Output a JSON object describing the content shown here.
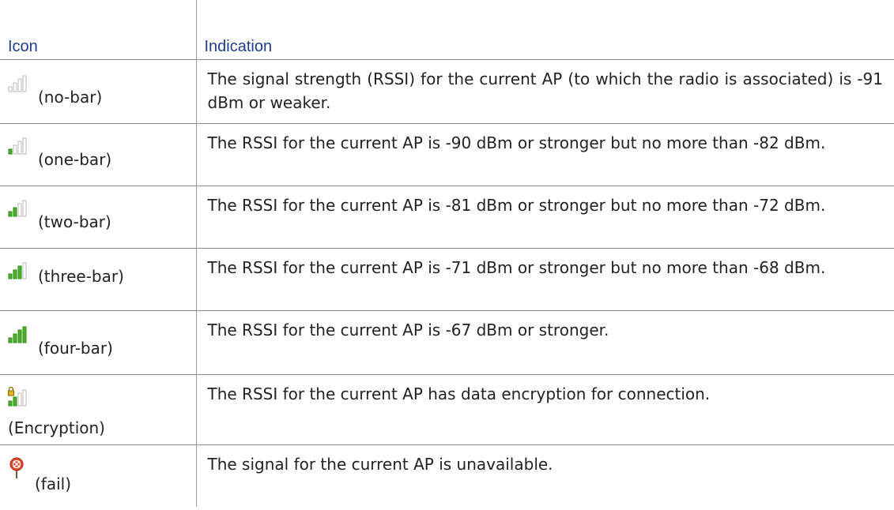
{
  "table": {
    "header": {
      "icon": "Icon",
      "indication": "Indication"
    },
    "rows": [
      {
        "label": "(no-bar)",
        "text": "The signal strength (RSSI) for the current AP (to which the radio is associated) is -91 dBm or weaker.",
        "bars_filled": 0,
        "icon": "signal-no-bar-icon"
      },
      {
        "label": "(one-bar)",
        "text": "The RSSI for the current AP is -90 dBm or stronger but no more than -82 dBm.",
        "bars_filled": 1,
        "icon": "signal-one-bar-icon"
      },
      {
        "label": "(two-bar)",
        "text": "The RSSI for the current AP is -81 dBm or stronger but no more than -72 dBm.",
        "bars_filled": 2,
        "icon": "signal-two-bar-icon"
      },
      {
        "label": "(three-bar)",
        "text": "The RSSI for the current AP is -71 dBm or stronger but no more than -68 dBm.",
        "bars_filled": 3,
        "icon": "signal-three-bar-icon"
      },
      {
        "label": "(four-bar)",
        "text": "The RSSI for the current AP is -67 dBm or stronger.",
        "bars_filled": 4,
        "icon": "signal-four-bar-icon"
      },
      {
        "label": "(Encryption)",
        "text": "The RSSI for the current AP has data encryption for connection.",
        "bars_filled": 2,
        "icon": "signal-encryption-icon"
      },
      {
        "label": "(fail)",
        "text": "The signal for the current AP is unavailable.",
        "icon": "signal-fail-icon"
      }
    ]
  },
  "colors": {
    "header_text": "#1f3c88",
    "bar_on": "#4caf2a",
    "bar_off": "#cfcfcf",
    "lock": "#d8a000",
    "fail": "#e0452a"
  }
}
